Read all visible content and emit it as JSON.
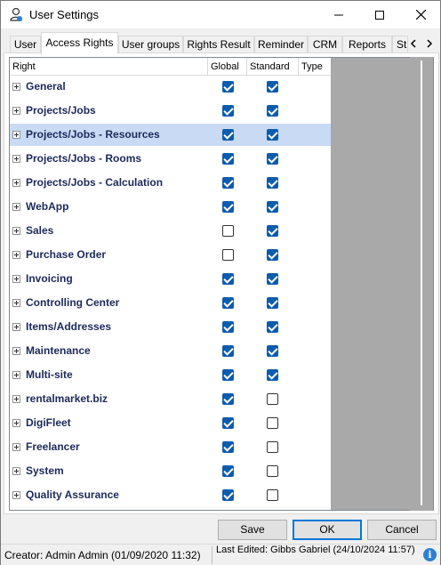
{
  "window": {
    "title": "User Settings",
    "minimize_glyph": "—",
    "maximize_glyph": "☐",
    "close_glyph": "✕"
  },
  "tabs": [
    {
      "label": "User",
      "active": false
    },
    {
      "label": "Access Rights",
      "active": true
    },
    {
      "label": "User groups",
      "active": false
    },
    {
      "label": "Rights Result",
      "active": false
    },
    {
      "label": "Reminder",
      "active": false
    },
    {
      "label": "CRM",
      "active": false
    },
    {
      "label": "Reports",
      "active": false
    },
    {
      "label": "St",
      "active": false
    }
  ],
  "grid": {
    "columns": {
      "right": "Right",
      "global": "Global",
      "standard": "Standard",
      "type": "Type"
    },
    "rows": [
      {
        "label": "General",
        "global": true,
        "standard": true,
        "selected": false
      },
      {
        "label": "Projects/Jobs",
        "global": true,
        "standard": true,
        "selected": false
      },
      {
        "label": "Projects/Jobs - Resources",
        "global": true,
        "standard": true,
        "selected": true
      },
      {
        "label": "Projects/Jobs - Rooms",
        "global": true,
        "standard": true,
        "selected": false
      },
      {
        "label": "Projects/Jobs - Calculation",
        "global": true,
        "standard": true,
        "selected": false
      },
      {
        "label": "WebApp",
        "global": true,
        "standard": true,
        "selected": false
      },
      {
        "label": "Sales",
        "global": false,
        "standard": true,
        "selected": false
      },
      {
        "label": "Purchase Order",
        "global": false,
        "standard": true,
        "selected": false
      },
      {
        "label": "Invoicing",
        "global": true,
        "standard": true,
        "selected": false
      },
      {
        "label": "Controlling Center",
        "global": true,
        "standard": true,
        "selected": false
      },
      {
        "label": "Items/Addresses",
        "global": true,
        "standard": true,
        "selected": false
      },
      {
        "label": "Maintenance",
        "global": true,
        "standard": true,
        "selected": false
      },
      {
        "label": "Multi-site",
        "global": true,
        "standard": true,
        "selected": false
      },
      {
        "label": "rentalmarket.biz",
        "global": true,
        "standard": false,
        "selected": false
      },
      {
        "label": "DigiFleet",
        "global": true,
        "standard": false,
        "selected": false
      },
      {
        "label": "Freelancer",
        "global": true,
        "standard": false,
        "selected": false
      },
      {
        "label": "System",
        "global": true,
        "standard": false,
        "selected": false
      },
      {
        "label": "Quality Assurance",
        "global": true,
        "standard": false,
        "selected": false
      }
    ]
  },
  "buttons": {
    "save": "Save",
    "ok": "OK",
    "cancel": "Cancel"
  },
  "status": {
    "creator": "Creator: Admin Admin (01/09/2020 11:32)",
    "last_edited": "Last Edited:  Gibbs Gabriel (24/10/2024 11:57)",
    "info_glyph": "i"
  },
  "colors": {
    "selected_row": "#c9daf4",
    "checkbox_checked": "#0b5cad",
    "label_text": "#1c2a5a",
    "default_button_border": "#0078d7"
  }
}
